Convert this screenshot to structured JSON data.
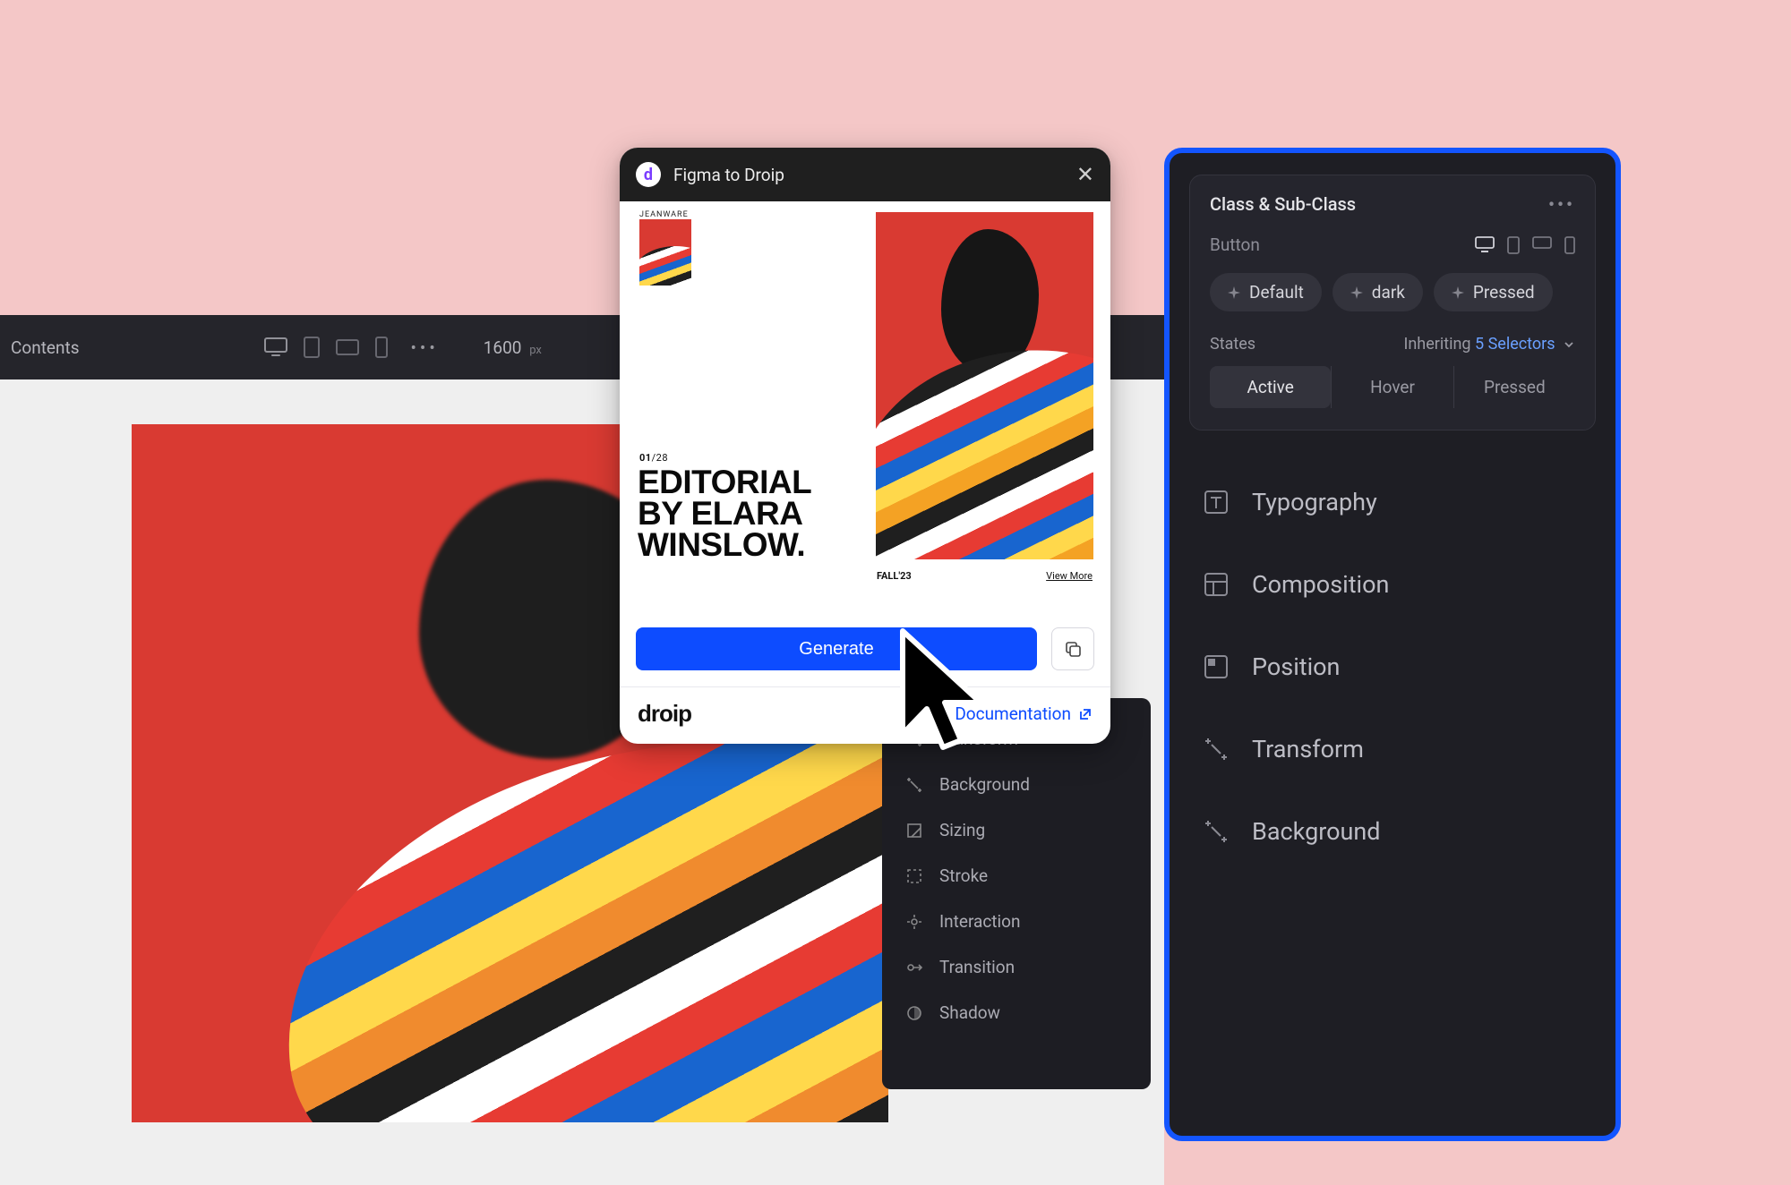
{
  "editor": {
    "contents_label": "Contents",
    "zoom_value": "1600",
    "zoom_unit": "px"
  },
  "modal": {
    "title": "Figma to Droip",
    "smalltop": "JEANWARE",
    "page_current": "01",
    "page_total": "28",
    "headline": "EDITORIAL\nBY ELARA\nWINSLOW.",
    "season": "FALL'23",
    "viewmore": "View More",
    "generate_label": "Generate",
    "brand": "droip",
    "doc_label": "Documentation"
  },
  "secondary_panel": {
    "items": [
      {
        "icon": "transform-icon",
        "label": "Transform"
      },
      {
        "icon": "background-icon",
        "label": "Background"
      },
      {
        "icon": "sizing-icon",
        "label": "Sizing"
      },
      {
        "icon": "stroke-icon",
        "label": "Stroke"
      },
      {
        "icon": "interaction-icon",
        "label": "Interaction"
      },
      {
        "icon": "transition-icon",
        "label": "Transition"
      },
      {
        "icon": "shadow-icon",
        "label": "Shadow"
      }
    ]
  },
  "inspector": {
    "card_title": "Class & Sub-Class",
    "selector_label": "Button",
    "pills": [
      "Default",
      "dark",
      "Pressed"
    ],
    "states_label": "States",
    "inherit_label": "Inheriting",
    "inherit_count": "5 Selectors",
    "states": [
      "Active",
      "Hover",
      "Pressed"
    ],
    "active_state": "Active",
    "sections": [
      {
        "icon": "typography-icon",
        "label": "Typography"
      },
      {
        "icon": "composition-icon",
        "label": "Composition"
      },
      {
        "icon": "position-icon",
        "label": "Position"
      },
      {
        "icon": "transform-icon",
        "label": "Transform"
      },
      {
        "icon": "background-icon",
        "label": "Background"
      }
    ]
  },
  "colors": {
    "accent_blue": "#1355ff",
    "button_blue": "#0d4cff",
    "panel_dark": "#1e1e24",
    "bg_pink": "#f4c7c7"
  }
}
